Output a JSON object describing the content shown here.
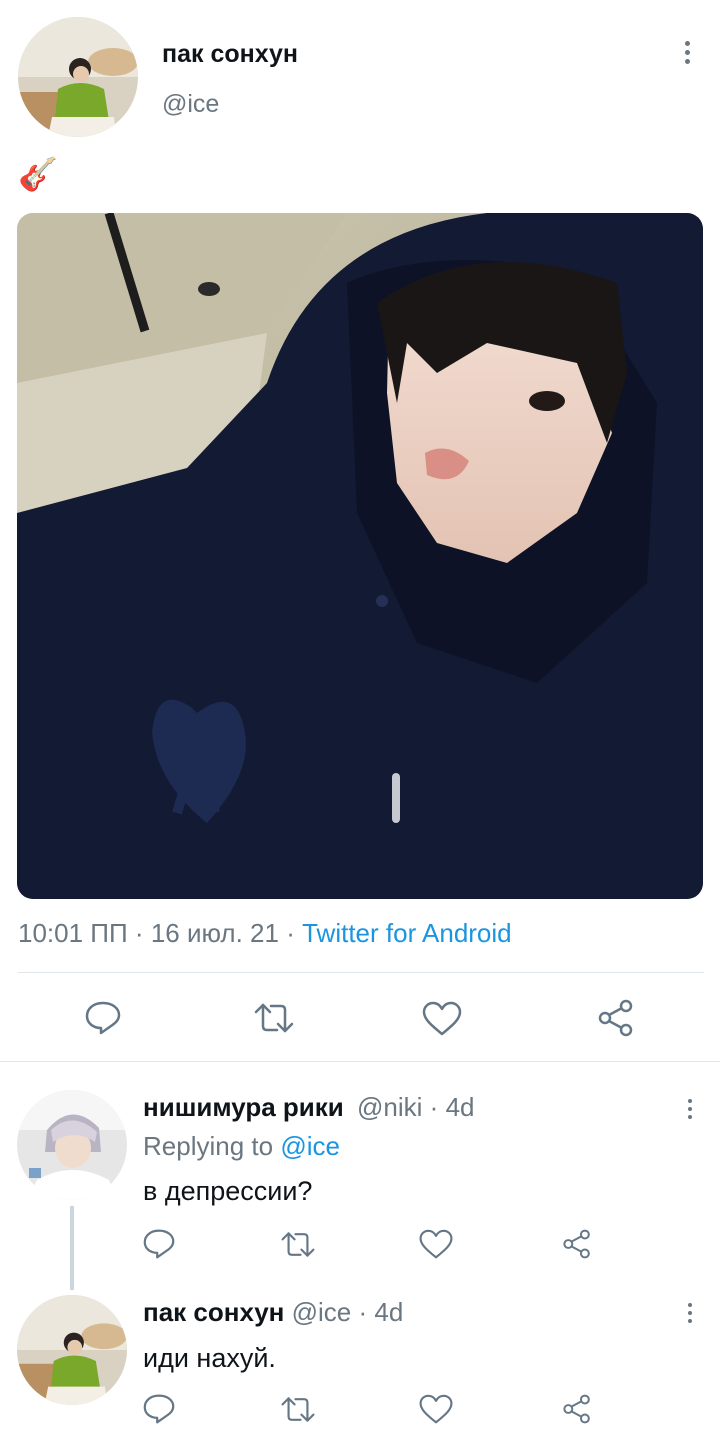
{
  "tweet": {
    "author_name": "пак сонхун",
    "author_handle": "@ice",
    "text_emoji": "🎸",
    "time": "10:01 ПП",
    "date": "16 июл. 21",
    "client": "Twitter for Android",
    "separator": "·"
  },
  "replies": [
    {
      "author_name": "нишимура рики",
      "author_handle": "@niki",
      "age": "4d",
      "replying_prefix": "Replying to",
      "replying_to": "@ice",
      "text": "в депрессии?"
    },
    {
      "author_name": "пак сонхун",
      "author_handle": "@ice",
      "age": "4d",
      "text": "иди нахуй."
    }
  ],
  "icons": {
    "reply": "reply-icon",
    "retweet": "retweet-icon",
    "like": "heart-icon",
    "share": "share-icon",
    "more": "more-vertical-icon"
  },
  "colors": {
    "link": "#1b95e0",
    "secondary_text": "#6a7680",
    "divider": "#e1e6ea",
    "hoodie": "#131a33"
  }
}
